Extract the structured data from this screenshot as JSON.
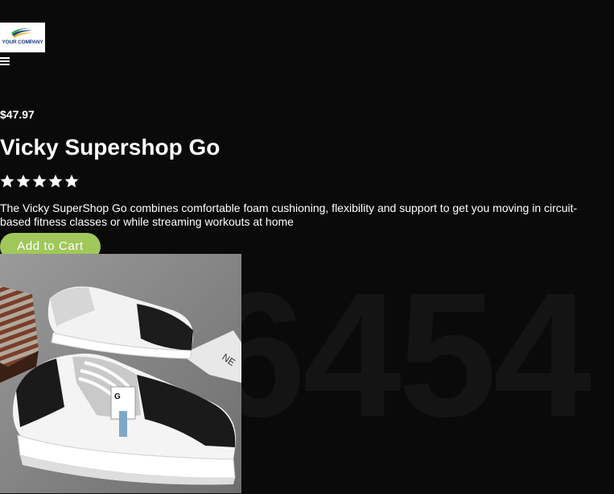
{
  "header": {
    "logo_text": "YOUR COMPANY",
    "menu_icon": "hamburger-menu-icon"
  },
  "product": {
    "price": "$47.97",
    "title": "Vicky Supershop Go",
    "rating": {
      "value": 5,
      "max": 5,
      "icon": "star-icon"
    },
    "description": "The Vicky SuperShop Go combines comfortable foam cushioning, flexibility and support to get you moving in circuit-based fitness classes or while streaming workouts at home",
    "add_to_cart_label": "Add to Cart",
    "image_alt": "sneaker-image"
  },
  "watermark": {
    "text": "6454"
  },
  "colors": {
    "background": "#0a0a0a",
    "text": "#ffffff",
    "button": "#a0c85a",
    "logo_blue": "#1a3c8c"
  }
}
